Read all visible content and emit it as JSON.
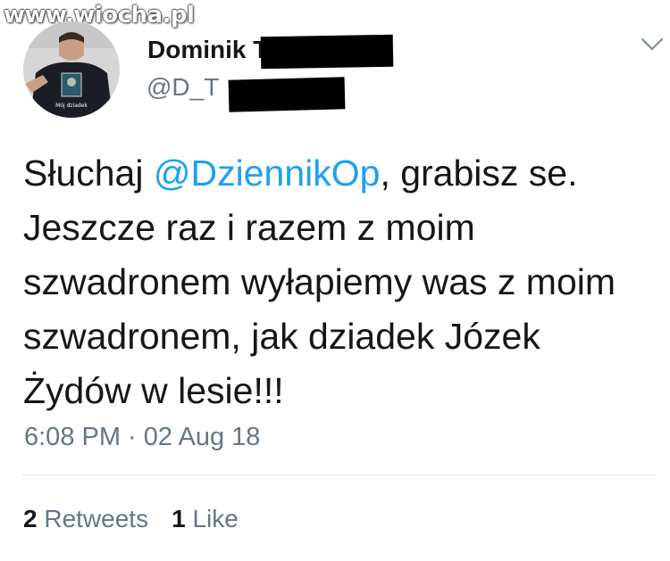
{
  "watermark": "www.wiocha.pl",
  "author": {
    "display_name": "Dominik T",
    "handle": "@D_T",
    "avatar_shirt_caption": "Mój dziadek"
  },
  "tweet": {
    "text_before": "Słuchaj ",
    "mention": "@DziennikOp",
    "text_after": ", grabisz se. Jeszcze raz i razem z moim szwadronem wyłapiemy was z moim szwadronem, jak dziadek Józek Żydów w lesie!!!",
    "timestamp": "6:08 PM · 02 Aug 18"
  },
  "stats": {
    "retweets_count": "2",
    "retweets_label": "Retweets",
    "likes_count": "1",
    "likes_label": "Like"
  },
  "colors": {
    "mention": "#1da1f2",
    "secondary_text": "#657786",
    "primary_text": "#14171a",
    "divider": "#e1e8ed"
  },
  "icons": {
    "menu": "chevron-down-icon"
  }
}
